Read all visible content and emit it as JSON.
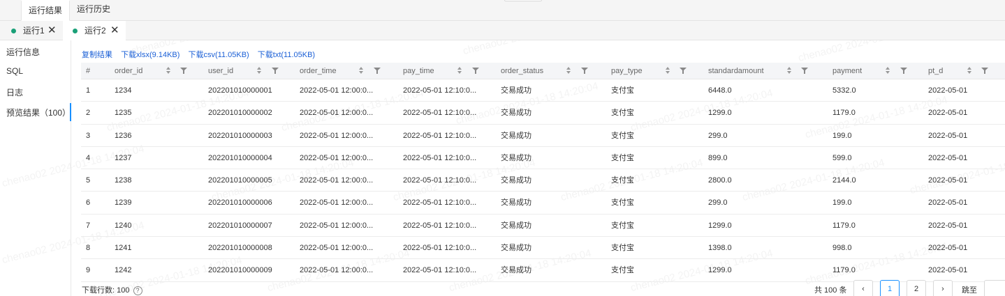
{
  "top_tabs": [
    "运行结果",
    "运行历史"
  ],
  "run_tabs": [
    {
      "label": "运行1"
    },
    {
      "label": "运行2"
    }
  ],
  "close_glyph": "✕",
  "nav": [
    "运行信息",
    "SQL",
    "日志",
    "预览结果（100）"
  ],
  "links": [
    "复制结果",
    "下载xlsx(9.14KB)",
    "下载csv(11.05KB)",
    "下载txt(11.05KB)"
  ],
  "columns": [
    "#",
    "order_id",
    "user_id",
    "order_time",
    "pay_time",
    "order_status",
    "pay_type",
    "standardamount",
    "payment",
    "pt_d"
  ],
  "rows": [
    [
      "1",
      "1234",
      "202201010000001",
      "2022-05-01 12:00:0...",
      "2022-05-01 12:10:0...",
      "交易成功",
      "支付宝",
      "6448.0",
      "5332.0",
      "2022-05-01"
    ],
    [
      "2",
      "1235",
      "202201010000002",
      "2022-05-01 12:00:0...",
      "2022-05-01 12:10:0...",
      "交易成功",
      "支付宝",
      "1299.0",
      "1179.0",
      "2022-05-01"
    ],
    [
      "3",
      "1236",
      "202201010000003",
      "2022-05-01 12:00:0...",
      "2022-05-01 12:10:0...",
      "交易成功",
      "支付宝",
      "299.0",
      "199.0",
      "2022-05-01"
    ],
    [
      "4",
      "1237",
      "202201010000004",
      "2022-05-01 12:00:0...",
      "2022-05-01 12:10:0...",
      "交易成功",
      "支付宝",
      "899.0",
      "599.0",
      "2022-05-01"
    ],
    [
      "5",
      "1238",
      "202201010000005",
      "2022-05-01 12:00:0...",
      "2022-05-01 12:10:0...",
      "交易成功",
      "支付宝",
      "2800.0",
      "2144.0",
      "2022-05-01"
    ],
    [
      "6",
      "1239",
      "202201010000006",
      "2022-05-01 12:00:0...",
      "2022-05-01 12:10:0...",
      "交易成功",
      "支付宝",
      "299.0",
      "199.0",
      "2022-05-01"
    ],
    [
      "7",
      "1240",
      "202201010000007",
      "2022-05-01 12:00:0...",
      "2022-05-01 12:10:0...",
      "交易成功",
      "支付宝",
      "1299.0",
      "1179.0",
      "2022-05-01"
    ],
    [
      "8",
      "1241",
      "202201010000008",
      "2022-05-01 12:00:0...",
      "2022-05-01 12:10:0...",
      "交易成功",
      "支付宝",
      "1398.0",
      "998.0",
      "2022-05-01"
    ],
    [
      "9",
      "1242",
      "202201010000009",
      "2022-05-01 12:00:0...",
      "2022-05-01 12:10:0...",
      "交易成功",
      "支付宝",
      "1299.0",
      "1179.0",
      "2022-05-01"
    ]
  ],
  "footer": {
    "download_rows_label": "下载行数:",
    "download_rows_value": "100",
    "help": "?",
    "total": "共 100 条",
    "prev": "‹",
    "pages": [
      "1",
      "2"
    ],
    "next": "›",
    "jump_label": "跳至"
  },
  "watermark": "chenao02 2024-01-18 14:20:04"
}
